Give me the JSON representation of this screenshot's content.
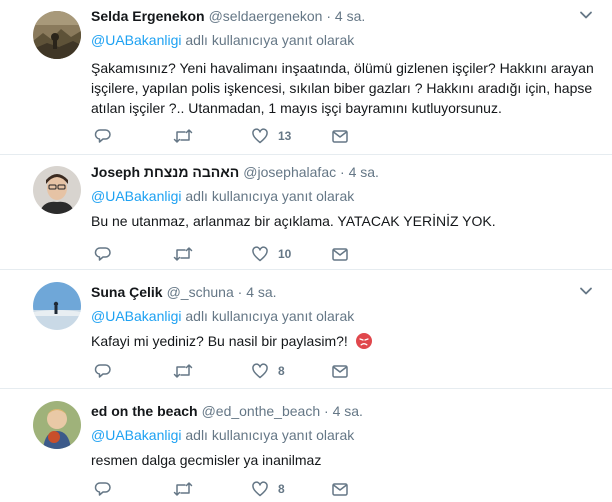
{
  "tweets": [
    {
      "name": "Selda Ergenekon",
      "handle": "@seldaergenekon",
      "separator": "·",
      "time": "4 sa.",
      "reply_mention": "@UABakanligi",
      "reply_suffix": "adlı kullanıcıya yanıt olarak",
      "text_lines": [
        "Şakamısınız? Yeni havalimanı inşaatında, ölümü gizlenen işçiler? Hakkını arayan",
        "işçilere, yapılan polis işkencesi, sıkılan biber gazları ? Hakkını aradığı için, hapse",
        "atılan işçiler ?.. Utanmadan, 1 mayıs işçi bayramını kutluyorsunuz."
      ],
      "like_count": "13",
      "avatar": "rocky-landscape"
    },
    {
      "name": "Joseph האהבה מנצחת",
      "handle": "@josephalafac",
      "separator": "·",
      "time": "4 sa.",
      "reply_mention": "@UABakanligi",
      "reply_suffix": "adlı kullanıcıya yanıt olarak",
      "text_lines": [
        "Bu ne utanmaz, arlanmaz bir açıklama. YATACAK YERİNİZ YOK."
      ],
      "like_count": "10",
      "avatar": "portrait-man"
    },
    {
      "name": "Suna Çelik",
      "handle": "@_schuna",
      "separator": "·",
      "time": "4 sa.",
      "reply_mention": "@UABakanligi",
      "reply_suffix": "adlı kullanıcıya yanıt olarak",
      "text_lines": [
        "Kafayi mi yediniz? Bu nasil bir paylasim?!"
      ],
      "emoji": "angry-face-icon",
      "like_count": "8",
      "avatar": "beach-person"
    },
    {
      "name": "ed on the beach",
      "handle": "@ed_onthe_beach",
      "separator": "·",
      "time": "4 sa.",
      "reply_mention": "@UABakanligi",
      "reply_suffix": "adlı kullanıcıya yanıt olarak",
      "text_lines": [
        "resmen dalga gecmisler ya inanilmaz"
      ],
      "like_count": "8",
      "avatar": "child-photo"
    }
  ],
  "colors": {
    "accent": "#1da1f2",
    "secondary_text": "#657786",
    "primary_text": "#14171a",
    "divider": "#e6ecf0"
  }
}
